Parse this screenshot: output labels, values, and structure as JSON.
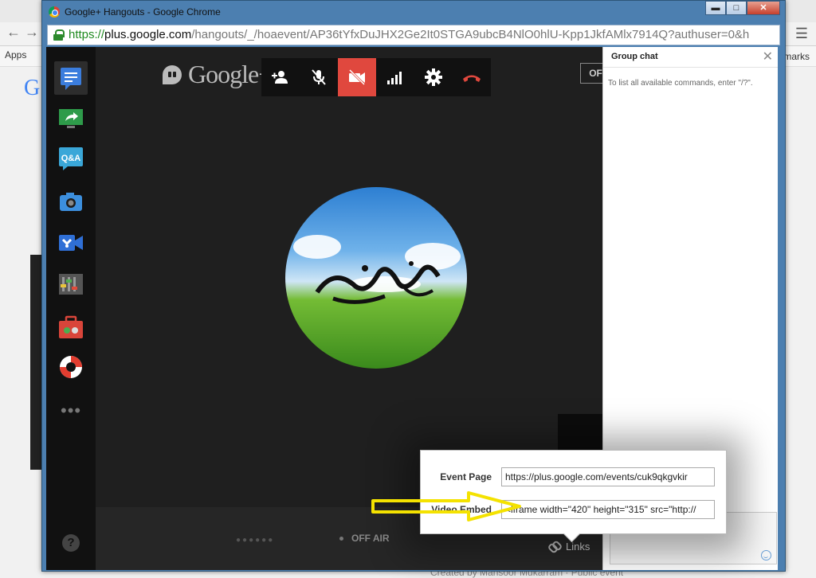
{
  "window": {
    "title": "Google+ Hangouts - Google Chrome",
    "btn_min": "▬",
    "btn_max": "□",
    "btn_close": "✕"
  },
  "address": {
    "scheme": "https://",
    "host": "plus.google.com",
    "path": "/hangouts/_/hoaevent/AP36tYfxDuJHX2Ge2It0STGA9ubcB4NlO0hlU-Kpp1JkfAMlx7914Q?authuser=0&h"
  },
  "background": {
    "apps_label": "Apps",
    "bookmarks_label": "marks",
    "footer_text": "Created by Mansoor Mukarram · Public event"
  },
  "stage": {
    "logo_text": "Google+",
    "off_air_button": "OFF AIR"
  },
  "bottom": {
    "status": "OFF AIR",
    "links_label": "Links"
  },
  "chat": {
    "title": "Group chat",
    "close": "✕",
    "hint": "To list all available commands, enter \"/?\"."
  },
  "links_popup": {
    "event_page_label": "Event Page",
    "event_page_value": "https://plus.google.com/events/cuk9qkgvkir",
    "video_embed_label": "Video Embed",
    "video_embed_value": "<iframe width=\"420\" height=\"315\" src=\"http://"
  },
  "colors": {
    "hangout_bg": "#1e1e1e",
    "video_off_red": "#e0483e",
    "arrow_yellow": "#f4e200"
  },
  "icons": {
    "sidebar": [
      "chat-icon",
      "screenshare-icon",
      "qa-icon",
      "camera-icon",
      "cameraman-icon",
      "control-room-icon",
      "toolbox-icon",
      "help-lifebuoy-icon",
      "more-apps-icon"
    ],
    "controls": [
      "invite-people-icon",
      "mic-muted-icon",
      "camera-off-icon",
      "bandwidth-icon",
      "settings-icon",
      "hang-up-icon"
    ]
  }
}
